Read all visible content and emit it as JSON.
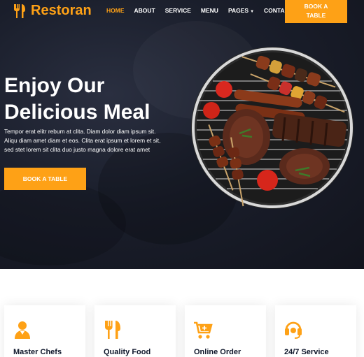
{
  "brand": {
    "name": "Restoran",
    "icon": "utensils-icon",
    "color": "#FEA116"
  },
  "nav": {
    "items": [
      {
        "label": "HOME",
        "active": true
      },
      {
        "label": "ABOUT",
        "active": false
      },
      {
        "label": "SERVICE",
        "active": false
      },
      {
        "label": "MENU",
        "active": false
      },
      {
        "label": "PAGES",
        "active": false,
        "dropdown": true
      },
      {
        "label": "CONTACT",
        "active": false
      }
    ],
    "book_button_line1": "BOOK A",
    "book_button_line2": "TABLE"
  },
  "hero": {
    "title_line1": "Enjoy Our",
    "title_line2": "Delicious Meal",
    "text_line1": "Tempor erat elitr rebum at clita. Diam dolor diam ipsum sit.",
    "text_line2": "Aliqu diam amet diam et eos. Clita erat ipsum et lorem et sit,",
    "text_line3": "sed stet lorem sit clita duo justo magna dolore erat amet",
    "button_label": "BOOK A TABLE",
    "image": "bbq-grill-image"
  },
  "services": [
    {
      "title": "Master Chefs",
      "icon": "chef-icon"
    },
    {
      "title": "Quality Food",
      "icon": "utensils-icon"
    },
    {
      "title": "Online Order",
      "icon": "cart-plus-icon"
    },
    {
      "title": "24/7 Service",
      "icon": "headset-icon"
    }
  ],
  "colors": {
    "accent": "#FEA116",
    "dark": "#0F172B",
    "hero_bg": "#1a1e2b"
  }
}
